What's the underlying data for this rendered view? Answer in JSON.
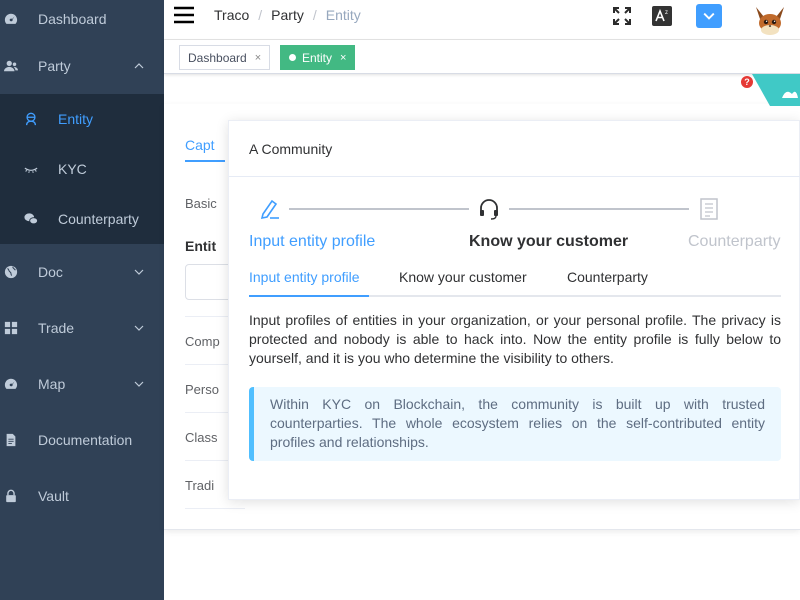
{
  "sidebar": {
    "dashboard": "Dashboard",
    "party": "Party",
    "party_children": [
      "Entity",
      "KYC",
      "Counterparty"
    ],
    "doc": "Doc",
    "trade": "Trade",
    "map": "Map",
    "documentation": "Documentation",
    "vault": "Vault"
  },
  "breadcrumb": [
    "Traco",
    "Party",
    "Entity"
  ],
  "tags": {
    "dashboard": "Dashboard",
    "entity": "Entity",
    "close": "×"
  },
  "background": {
    "tab_fragment": "Capt",
    "basic_fragment": "Basic",
    "entity_fragment": "Entit",
    "row_labels": [
      "Comp",
      "Perso",
      "Class",
      "Tradi"
    ]
  },
  "popover": {
    "title": "A Community",
    "steps": [
      "Input entity profile",
      "Know your customer",
      "Counterparty"
    ],
    "tabs": [
      "Input entity profile",
      "Know your customer",
      "Counterparty"
    ],
    "description": "Input profiles of entities in your organization, or your personal profile. The privacy is protected and nobody is able to hack into. Now the entity profile is fully below to yourself, and it is you who determine the visibility to others.",
    "tip": "Within KYC on Blockchain, the community is built up with trusted counterparties. The whole ecosystem relies on the self-contributed entity profiles and relationships."
  },
  "icons": {
    "dashboard": "dashboard-icon",
    "party": "people-icon",
    "entity": "user-icon",
    "kyc": "eye-icon",
    "counterparty": "chat-icon",
    "doc": "globe-icon",
    "trade": "grid-icon",
    "map": "dashboard-icon",
    "documentation": "document-icon",
    "vault": "lock-icon",
    "fullscreen": "fullscreen-icon",
    "language": "translate-icon",
    "avatar": "fox-avatar"
  },
  "colors": {
    "sidebar_bg": "#304156",
    "submenu_bg": "#1f2d3d",
    "active": "#409eff",
    "tag_active": "#42b983",
    "tip_bg": "#ecf8ff",
    "tip_border": "#50bfff"
  }
}
